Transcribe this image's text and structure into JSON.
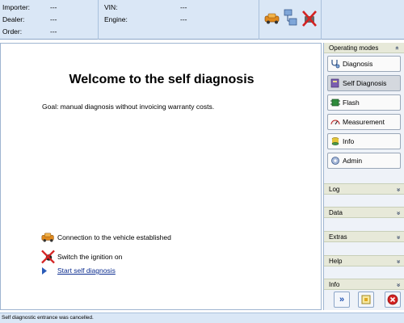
{
  "header": {
    "importer_label": "Importer:",
    "importer_value": "---",
    "dealer_label": "Dealer:",
    "dealer_value": "---",
    "order_label": "Order:",
    "order_value": "---",
    "vin_label": "VIN:",
    "vin_value": "---",
    "engine_label": "Engine:",
    "engine_value": "---",
    "icons": [
      "vehicle-icon",
      "network-icon",
      "disconnected-icon"
    ]
  },
  "main": {
    "title": "Welcome to the self diagnosis",
    "goal": "Goal: manual diagnosis without invoicing warranty costs.",
    "status1": "Connection to the vehicle established",
    "status2": "Switch the ignition on",
    "start_link": "Start self diagnosis"
  },
  "sidebar": {
    "section_title": "Operating modes",
    "items": [
      {
        "label": "Diagnosis",
        "icon": "stethoscope-icon"
      },
      {
        "label": "Self Diagnosis",
        "icon": "book-icon"
      },
      {
        "label": "Flash",
        "icon": "chip-icon"
      },
      {
        "label": "Measurement",
        "icon": "meter-icon"
      },
      {
        "label": "Info",
        "icon": "database-icon"
      },
      {
        "label": "Admin",
        "icon": "admin-icon"
      }
    ],
    "collapsed": [
      {
        "label": "Log"
      },
      {
        "label": "Data"
      },
      {
        "label": "Extras"
      },
      {
        "label": "Help"
      },
      {
        "label": "Info"
      }
    ],
    "chevron": "»"
  },
  "toolbar": {
    "forward": "»"
  },
  "statusbar": {
    "text": "Self diagnostic entrance was cancelled."
  },
  "colors": {
    "header_bg": "#dae7f6",
    "accent_link": "#0b2c8f",
    "active_button": "#d4d8de",
    "section_bar": "#e7e9d9"
  }
}
